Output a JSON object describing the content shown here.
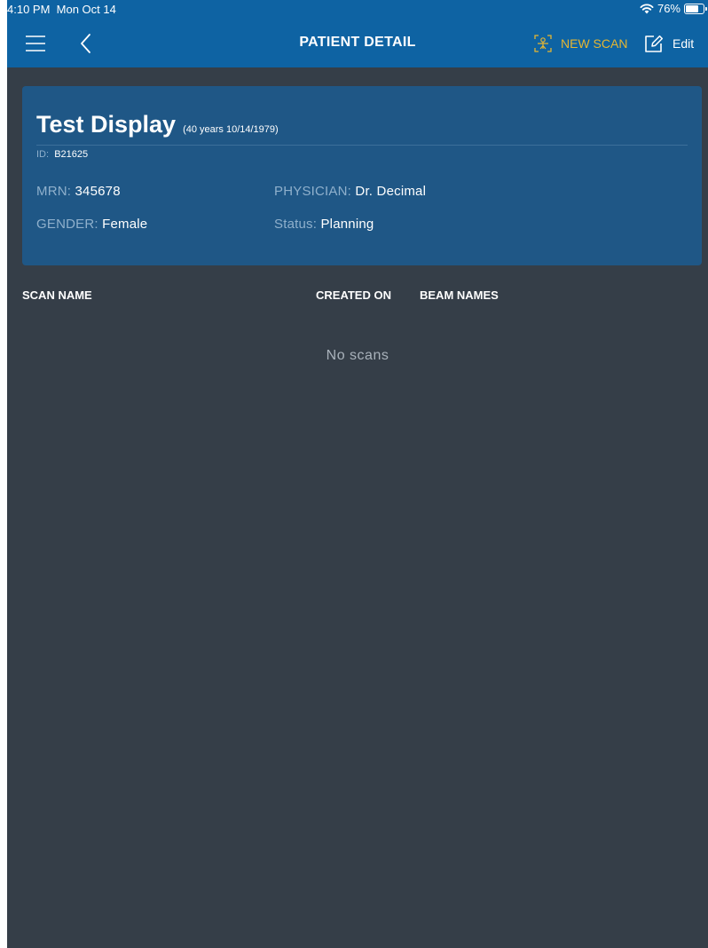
{
  "status_bar": {
    "time": "4:10 PM",
    "date": "Mon Oct 14",
    "battery": "76%",
    "battery_level": 0.76
  },
  "nav": {
    "title": "PATIENT DETAIL",
    "new_scan_label": "NEW SCAN",
    "edit_label": "Edit",
    "accent_color": "#e5b632",
    "bar_color": "#0e63a3"
  },
  "patient": {
    "name": "Test Display",
    "age_dob": "(40 years 10/14/1979)",
    "id_label": "ID:",
    "id": "B21625",
    "mrn_label": "MRN:",
    "mrn": "345678",
    "physician_label": "PHYSICIAN:",
    "physician": "Dr. Decimal",
    "gender_label": "GENDER:",
    "gender": "Female",
    "status_label": "Status:",
    "status": "Planning"
  },
  "scans_table": {
    "columns": [
      "SCAN NAME",
      "CREATED ON",
      "BEAM NAMES"
    ],
    "empty_message": "No scans"
  },
  "icons": [
    "wifi-icon",
    "battery-icon",
    "menu-icon",
    "back-chevron-icon",
    "scan-icon",
    "edit-icon"
  ]
}
